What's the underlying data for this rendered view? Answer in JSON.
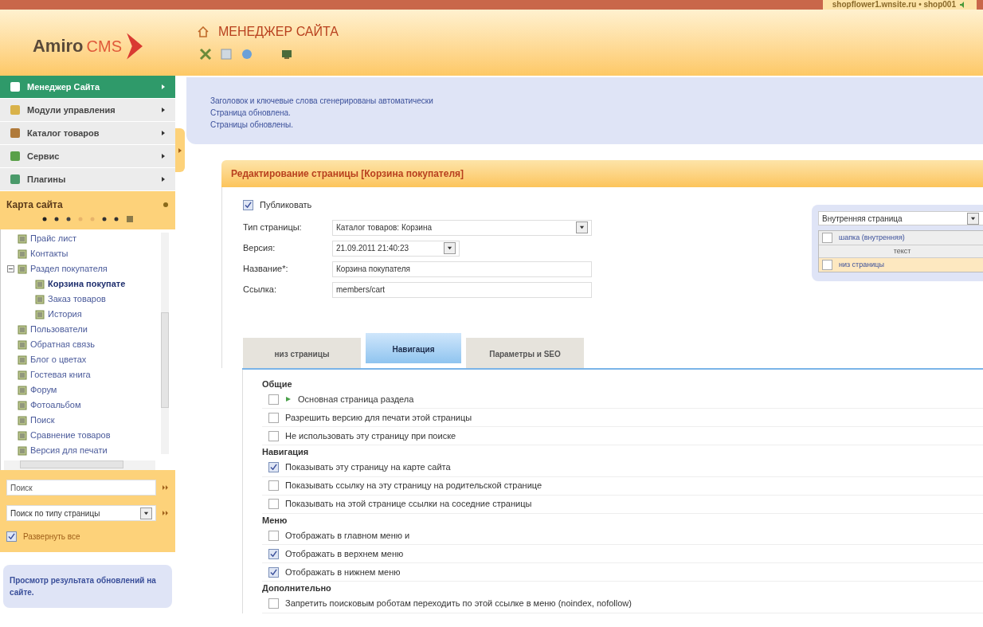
{
  "top_bar": {
    "site": "shopflower1.wnsite.ru • shop001"
  },
  "header": {
    "logo": {
      "brand": "Amiro",
      "suffix": "CMS"
    },
    "title": "МЕНЕДЖЕР САЙТА"
  },
  "sidebar": {
    "menu": [
      {
        "label": "Менеджер Сайта",
        "selected": true
      },
      {
        "label": "Модули управления",
        "selected": false
      },
      {
        "label": "Каталог товаров",
        "selected": false
      },
      {
        "label": "Сервис",
        "selected": false
      },
      {
        "label": "Плагины",
        "selected": false
      }
    ],
    "sitemap": {
      "title": "Карта сайта",
      "tree": [
        {
          "label": "Прайс лист",
          "selected": false
        },
        {
          "label": "Контакты",
          "selected": false
        },
        {
          "label": "Раздел покупателя",
          "selected": false,
          "expanded": true,
          "children": [
            {
              "label": "Корзина покупате",
              "selected": true
            },
            {
              "label": "Заказ товаров",
              "selected": false
            },
            {
              "label": "История",
              "selected": false
            }
          ]
        },
        {
          "label": "Пользователи",
          "selected": false
        },
        {
          "label": "Обратная связь",
          "selected": false
        },
        {
          "label": "Блог о цветах",
          "selected": false
        },
        {
          "label": "Гостевая книга",
          "selected": false
        },
        {
          "label": "Форум",
          "selected": false
        },
        {
          "label": "Фотоальбом",
          "selected": false
        },
        {
          "label": "Поиск",
          "selected": false
        },
        {
          "label": "Сравнение товаров",
          "selected": false
        },
        {
          "label": "Версия для печати",
          "selected": false
        }
      ]
    },
    "search": {
      "placeholder": "Поиск",
      "filter": "Поиск по типу страницы",
      "expand_all": {
        "label": "Развернуть все",
        "checked": true
      }
    },
    "preview_note": "Просмотр результата обновлений на сайте."
  },
  "messages": [
    "Заголовок и ключевые слова сгенерированы автоматически",
    "Страница обновлена.",
    "Страницы обновлены."
  ],
  "editor": {
    "title": "Редактирование страницы [Корзина покупателя]",
    "publish": {
      "label": "Публиковать",
      "checked": true
    },
    "fields": [
      {
        "label": "Тип страницы:",
        "value": "Каталог товаров: Корзина",
        "kind": "select"
      },
      {
        "label": "Версия:",
        "value": "21.09.2011 21:40:23",
        "kind": "short_select"
      },
      {
        "label": "Название*:",
        "value": "Корзина покупателя",
        "kind": "text"
      },
      {
        "label": "Ссылка:",
        "value": "members/cart",
        "kind": "text"
      }
    ],
    "layout": {
      "select": "Внутренняя страница",
      "blocks": [
        {
          "label": "шапка (внутренняя)",
          "kind": "check",
          "checked": false
        },
        {
          "label": "текст",
          "kind": "center"
        },
        {
          "label": "низ страницы",
          "kind": "check",
          "checked": false
        }
      ]
    },
    "tabs": [
      {
        "label": "низ страницы",
        "selected": false
      },
      {
        "label": "Навигация",
        "selected": true
      },
      {
        "label": "Параметры и SEO",
        "selected": false
      }
    ],
    "sections": [
      {
        "title": "Общие",
        "options": [
          {
            "label": "Основная страница раздела",
            "checked": false,
            "kind": "marked"
          },
          {
            "label": "Разрешить версию для печати этой страницы",
            "checked": false,
            "kind": "plain"
          },
          {
            "label": "Не использовать эту страницу при поиске",
            "checked": false,
            "kind": "plain"
          }
        ]
      },
      {
        "title": "Навигация",
        "options": [
          {
            "label": "Показывать эту страницу на карте сайта",
            "checked": true,
            "kind": "plain"
          },
          {
            "label": "Показывать ссылку на эту страницу на родительской странице",
            "checked": false,
            "kind": "plain"
          },
          {
            "label": "Показывать на этой странице ссылки на соседние страницы",
            "checked": false,
            "kind": "plain"
          }
        ]
      },
      {
        "title": "Меню",
        "options": [
          {
            "label": "Отображать в главном меню и",
            "checked": false,
            "kind": "plain"
          },
          {
            "label": "Отображать в верхнем меню",
            "checked": true,
            "kind": "plain"
          },
          {
            "label": "Отображать в нижнем меню",
            "checked": true,
            "kind": "plain"
          }
        ]
      },
      {
        "title": "Дополнительно",
        "options": [
          {
            "label": "Запретить поисковым роботам переходить по этой ссылке в меню (noindex, nofollow)",
            "checked": false,
            "kind": "plain"
          }
        ]
      }
    ]
  }
}
